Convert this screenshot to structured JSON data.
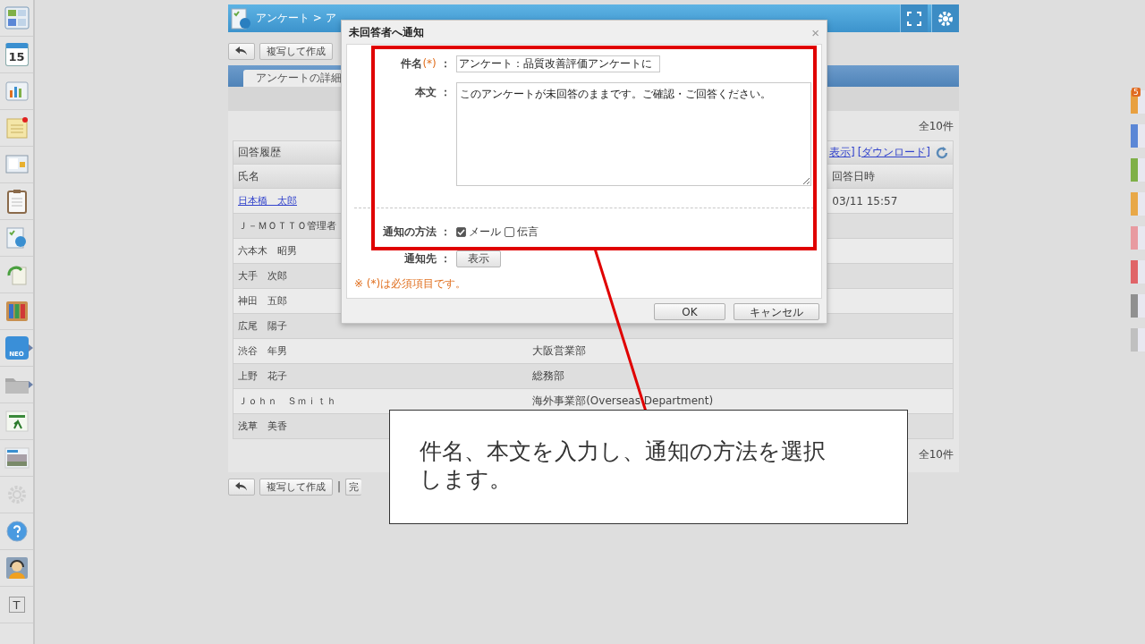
{
  "sidebar": {
    "calendar_day": "15",
    "neo_label": "NEO",
    "text_icon": "T"
  },
  "header": {
    "title": "アンケート > ア"
  },
  "toolbar": {
    "copy_button": "複写して作成"
  },
  "tabs": [
    {
      "label": "アンケートの詳細",
      "selected": true
    }
  ],
  "total_top": "全10件",
  "history": {
    "title": "回答履歴",
    "links": [
      "表示]",
      "[ダウンロード]"
    ]
  },
  "table": {
    "columns": [
      "氏名",
      "",
      "回答日時"
    ],
    "rows": [
      {
        "name": "日本橋　太郎",
        "link": true,
        "department": "",
        "date": "03/11 15:57"
      },
      {
        "name": "Ｊ－ＭＯＴＴＯ管理者",
        "link": false,
        "department": "",
        "date": ""
      },
      {
        "name": "六本木　昭男",
        "link": false,
        "department": "",
        "date": ""
      },
      {
        "name": "大手　次郎",
        "link": false,
        "department": "",
        "date": ""
      },
      {
        "name": "神田　五郎",
        "link": false,
        "department": "",
        "date": ""
      },
      {
        "name": "広尾　陽子",
        "link": false,
        "department": "",
        "date": ""
      },
      {
        "name": "渋谷　年男",
        "link": false,
        "department": "大阪営業部",
        "date": ""
      },
      {
        "name": "上野　花子",
        "link": false,
        "department": "総務部",
        "date": ""
      },
      {
        "name": "Ｊｏｈｎ　Ｓｍｉｔｈ",
        "link": false,
        "department": "海外事業部(Overseas Department)",
        "date": ""
      },
      {
        "name": "浅草　美香",
        "link": false,
        "department": "",
        "date": ""
      }
    ]
  },
  "total_bottom": "全10件",
  "bottom_toolbar": {
    "copy_button": "複写して作成",
    "separator": "|",
    "complete_button": "完"
  },
  "right_tabs": [
    {
      "color": "#e8a040",
      "badge": "5"
    },
    {
      "color": "#5b87d6"
    },
    {
      "color": "#7fb048"
    },
    {
      "color": "#e8a848"
    },
    {
      "color": "#e89aa0"
    },
    {
      "color": "#e06468"
    },
    {
      "color": "#909090"
    },
    {
      "color": "#c0c0c0"
    }
  ],
  "dialog": {
    "title": "未回答者へ通知",
    "close": "×",
    "subject_label": "件名",
    "required_mark": "(*)",
    "colon": "：",
    "subject_value": "アンケート：品質改善評価アンケートに",
    "body_label": "本文",
    "body_value": "このアンケートが未回答のままです。ご確認・ご回答ください。",
    "method_label": "通知の方法",
    "methods": [
      {
        "label": "メール",
        "checked": true
      },
      {
        "label": "伝言",
        "checked": false
      }
    ],
    "recipient_label": "通知先",
    "recipient_button": "表示",
    "note": "※ (*)は必須項目です。",
    "ok": "OK",
    "cancel": "キャンセル"
  },
  "callout": {
    "text": "件名、本文を入力し、通知の方法を選択します。"
  }
}
